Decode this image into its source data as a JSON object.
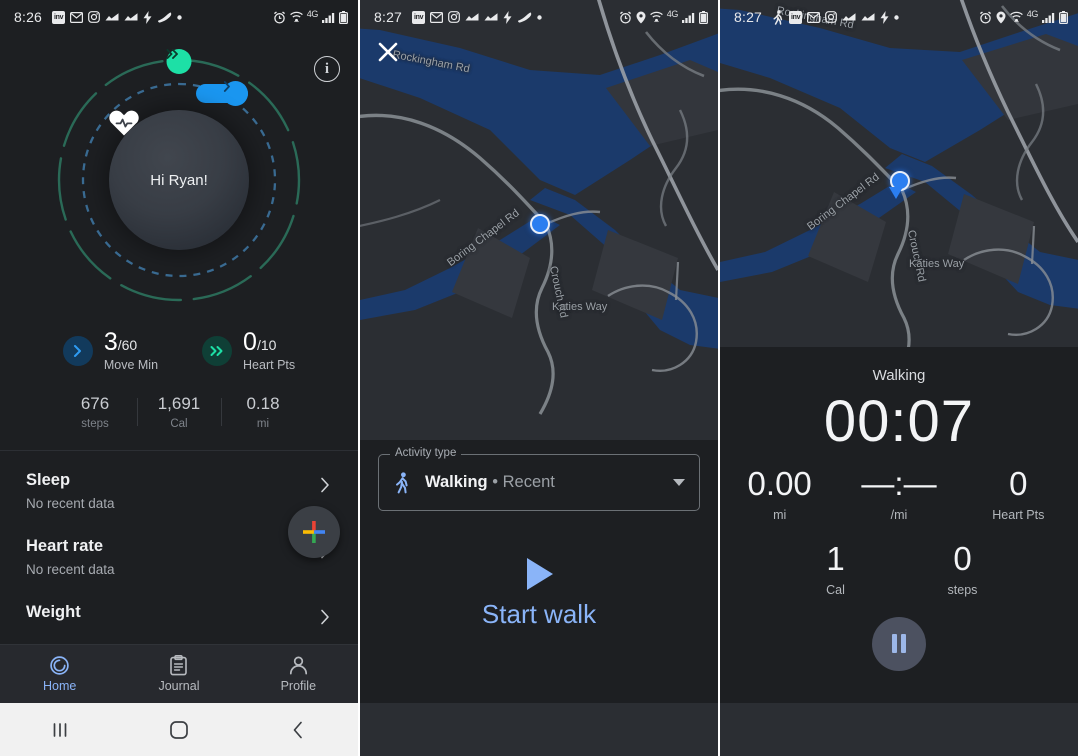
{
  "panels": {
    "home": {
      "statusbar": {
        "time": "8:26",
        "left_icons": [
          "inv-app-icon",
          "gmail-icon",
          "instagram-icon",
          "chart-icon",
          "chart-icon",
          "lightning-bolt-icon",
          "sneaker-icon",
          "dot-icon"
        ],
        "right_icons": [
          "alarm-icon",
          "wifi-icon",
          "network-4g-label",
          "signal-bars-icon",
          "battery-icon"
        ],
        "network": "4G"
      },
      "info_button": "i",
      "greeting": "Hi Ryan!",
      "goals": [
        {
          "icon": "chevron-right-icon",
          "value": "3",
          "goal": "/60",
          "label": "Move Min",
          "color": "#1a96f0"
        },
        {
          "icon": "double-chevron-right-icon",
          "value": "0",
          "goal": "/10",
          "label": "Heart Pts",
          "color": "#1de0a6"
        }
      ],
      "metrics": [
        {
          "value": "676",
          "label": "steps"
        },
        {
          "value": "1,691",
          "label": "Cal"
        },
        {
          "value": "0.18",
          "label": "mi"
        }
      ],
      "list": [
        {
          "title": "Sleep",
          "subtitle": "No recent data"
        },
        {
          "title": "Heart rate",
          "subtitle": "No recent data"
        },
        {
          "title": "Weight",
          "subtitle": ""
        }
      ],
      "fab": "add-icon",
      "tabs": [
        {
          "label": "Home",
          "icon": "home-activity-icon",
          "active": true
        },
        {
          "label": "Journal",
          "icon": "clipboard-icon",
          "active": false
        },
        {
          "label": "Profile",
          "icon": "person-icon",
          "active": false
        }
      ],
      "navbar": [
        {
          "name": "recents-button",
          "glyph": "|||"
        },
        {
          "name": "home-button",
          "glyph": "◯"
        },
        {
          "name": "back-button",
          "glyph": "‹"
        }
      ]
    },
    "start": {
      "statusbar": {
        "time": "8:27",
        "left_icons": [
          "inv-app-icon",
          "gmail-icon",
          "instagram-icon",
          "chart-icon",
          "chart-icon",
          "lightning-bolt-icon",
          "sneaker-icon",
          "dot-icon"
        ],
        "right_icons": [
          "alarm-icon",
          "location-pin-icon",
          "wifi-icon",
          "network-4g-label",
          "signal-bars-icon",
          "battery-icon"
        ],
        "network": "4G"
      },
      "close_button": "close-icon",
      "map_labels": [
        "Rockingham Rd",
        "Boring Chapel Rd",
        "Crouch Rd",
        "Katies Way"
      ],
      "activity_field": {
        "legend": "Activity type",
        "icon": "walking-person-icon",
        "value": "Walking",
        "suffix": "• Recent",
        "caret": "chevron-down-icon"
      },
      "start_button": {
        "icon": "play-icon",
        "label": "Start walk"
      },
      "navbar": [
        {
          "name": "recents-button",
          "glyph": "|||"
        },
        {
          "name": "home-button",
          "glyph": "◯"
        },
        {
          "name": "back-button",
          "glyph": "‹"
        }
      ]
    },
    "tracking": {
      "statusbar": {
        "time": "8:27",
        "left_icons": [
          "walking-person-icon",
          "inv-app-icon",
          "gmail-icon",
          "instagram-icon",
          "chart-icon",
          "chart-icon",
          "lightning-bolt-icon",
          "dot-icon"
        ],
        "right_icons": [
          "alarm-icon",
          "location-pin-icon",
          "wifi-icon",
          "network-4g-label",
          "signal-bars-icon",
          "battery-icon"
        ],
        "network": "4G"
      },
      "map_labels": [
        "Rockingham Rd",
        "Boring Chapel Rd",
        "Crouch Rd",
        "Katies Way"
      ],
      "activity": "Walking",
      "timer": "00:07",
      "primary_stats": [
        {
          "value": "0.00",
          "label": "mi"
        },
        {
          "value": "—:—",
          "label": "/mi"
        },
        {
          "value": "0",
          "label": "Heart Pts"
        }
      ],
      "secondary_stats": [
        {
          "value": "1",
          "label": "Cal"
        },
        {
          "value": "0",
          "label": "steps"
        }
      ],
      "pause_button": "pause-icon",
      "navbar": [
        {
          "name": "recents-button",
          "glyph": "|||"
        },
        {
          "name": "home-button",
          "glyph": "◯"
        },
        {
          "name": "back-button",
          "glyph": "‹"
        }
      ]
    }
  },
  "colors": {
    "background": "#1d1f22",
    "accent_blue": "#1a96f0",
    "accent_green": "#1de0a6",
    "tab_active": "#8ab4f8",
    "map_water": "#1b3a6b",
    "map_land": "#2b2e33"
  }
}
